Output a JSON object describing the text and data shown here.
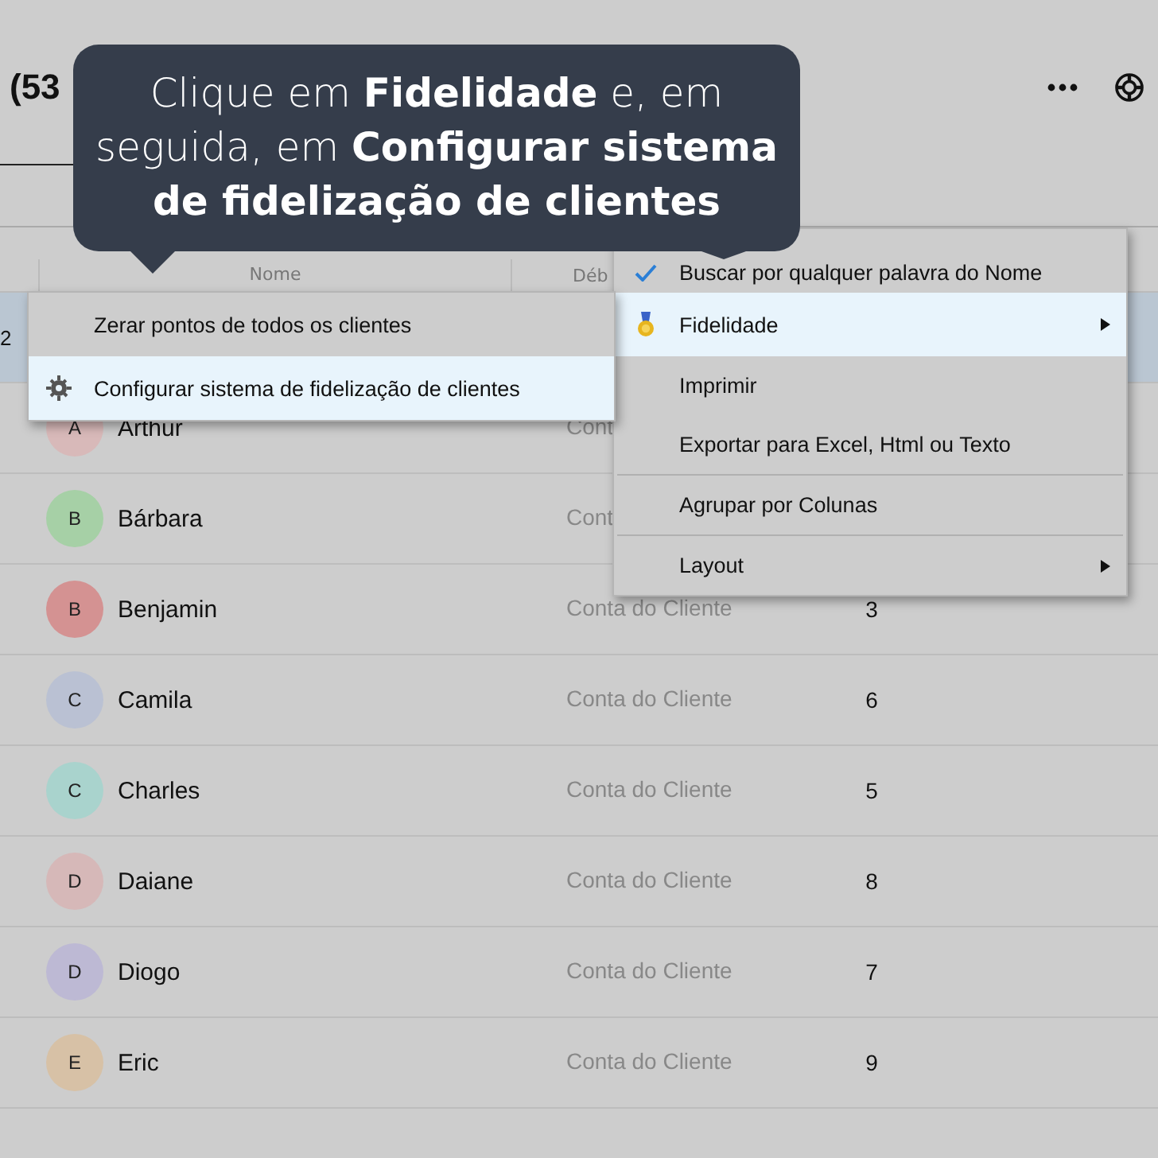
{
  "header": {
    "title": "(53"
  },
  "table": {
    "columns": [
      {
        "label": "Nome"
      },
      {
        "label": "Déb"
      }
    ],
    "rows": [
      {
        "selected": true,
        "leading": "2"
      },
      {
        "selected": false,
        "initial": "A",
        "color": "#d8b9b9",
        "name": "Arthur",
        "account": "Cont"
      },
      {
        "selected": false,
        "initial": "B",
        "color": "#a6d0a6",
        "name": "Bárbara",
        "account": "Cont"
      },
      {
        "selected": false,
        "initial": "B",
        "color": "#d49292",
        "name": "Benjamin",
        "account": "Conta do Cliente",
        "count": "3"
      },
      {
        "selected": false,
        "initial": "C",
        "color": "#bac1d3",
        "name": "Camila",
        "account": "Conta do Cliente",
        "count": "6"
      },
      {
        "selected": false,
        "initial": "C",
        "color": "#a9d3cd",
        "name": "Charles",
        "account": "Conta do Cliente",
        "count": "5"
      },
      {
        "selected": false,
        "initial": "D",
        "color": "#d6b8b8",
        "name": "Daiane",
        "account": "Conta do Cliente",
        "count": "8"
      },
      {
        "selected": false,
        "initial": "D",
        "color": "#bdb9d4",
        "name": "Diogo",
        "account": "Conta do Cliente",
        "count": "7"
      },
      {
        "selected": false,
        "initial": "E",
        "color": "#d7c1a6",
        "name": "Eric",
        "account": "Conta do Cliente",
        "count": "9"
      }
    ]
  },
  "context_menu": {
    "items": [
      {
        "kind": "item",
        "label": "Buscar por qualquer palavra do Nome",
        "checked": true,
        "selected": false,
        "submenu": false
      },
      {
        "kind": "item",
        "label": "Fidelidade",
        "checked": false,
        "selected": true,
        "submenu": true
      },
      {
        "kind": "item",
        "label": "Imprimir",
        "checked": false,
        "selected": false,
        "submenu": false
      },
      {
        "kind": "item",
        "label": "Exportar para Excel, Html ou Texto",
        "checked": false,
        "selected": false,
        "submenu": false
      },
      {
        "kind": "separator"
      },
      {
        "kind": "item",
        "label": "Agrupar por Colunas",
        "checked": false,
        "selected": false,
        "submenu": false
      },
      {
        "kind": "separator"
      },
      {
        "kind": "item",
        "label": "Layout",
        "checked": false,
        "selected": false,
        "submenu": true
      }
    ]
  },
  "submenu": {
    "items": [
      {
        "label": "Zerar pontos de todos os clientes",
        "selected": false
      },
      {
        "label": "Configurar sistema de fidelização de clientes",
        "selected": true
      }
    ]
  },
  "tooltip": {
    "text": "Clique em **Fidelidade** e, em seguida, em **Configurar sistema de fidelização de clientes**"
  }
}
